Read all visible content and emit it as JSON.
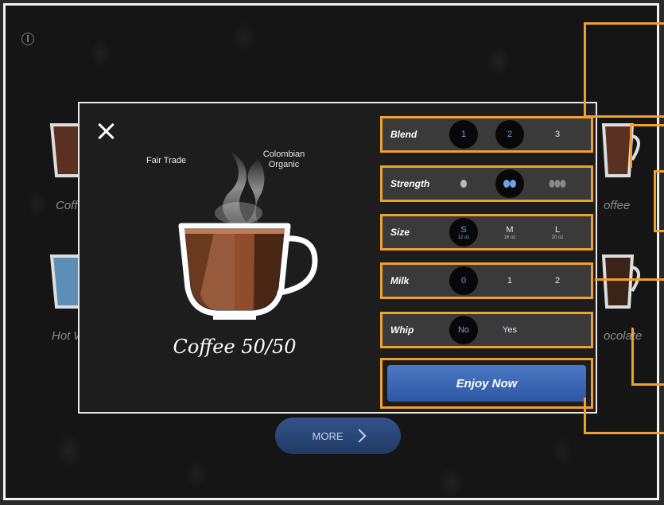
{
  "background": {
    "items": [
      {
        "label": "Coff"
      },
      {
        "label": "Hot W"
      },
      {
        "label": "offee"
      },
      {
        "label": "ocolate"
      }
    ]
  },
  "modal": {
    "tags": {
      "left": "Fair Trade",
      "right_line1": "Colombian",
      "right_line2": "Organic"
    },
    "coffee_name": "Coffee 50/50",
    "options": {
      "blend": {
        "label": "Blend",
        "values": [
          "1",
          "2",
          "3"
        ],
        "selected": [
          "1",
          "2"
        ]
      },
      "strength": {
        "label": "Strength",
        "selected_level": 2,
        "levels": 3
      },
      "size": {
        "label": "Size",
        "values": [
          {
            "label": "S",
            "sub": "12 oz"
          },
          {
            "label": "M",
            "sub": "16 oz"
          },
          {
            "label": "L",
            "sub": "20 oz"
          }
        ],
        "selected": "S"
      },
      "milk": {
        "label": "Milk",
        "values": [
          "0",
          "1",
          "2"
        ],
        "selected": "0"
      },
      "whip": {
        "label": "Whip",
        "values": [
          "No",
          "Yes"
        ],
        "selected": "No"
      }
    },
    "enjoy_label": "Enjoy Now"
  },
  "more_label": "MORE",
  "colors": {
    "accent": "#f0a030",
    "button_blue": "#3a66b3",
    "selected_text": "#6fa0e6"
  }
}
